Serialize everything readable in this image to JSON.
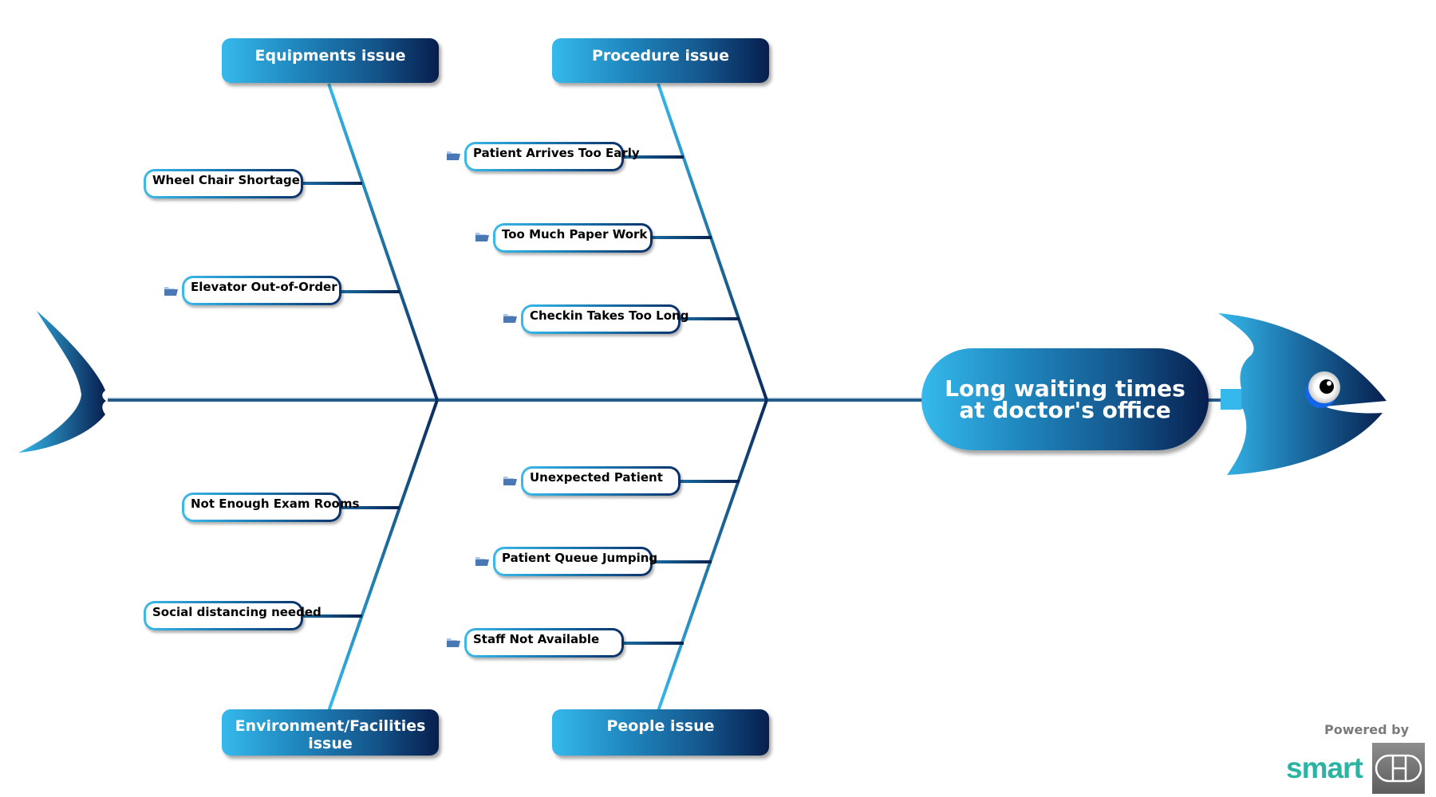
{
  "diagram_type": "fishbone",
  "head": {
    "line1": "Long waiting times",
    "line2": "at doctor's office"
  },
  "categories": [
    {
      "label": "Equipments issue",
      "causes": [
        {
          "label": "Wheel Chair Shortage",
          "has_folder_icon": false
        },
        {
          "label": "Elevator Out-of-Order",
          "has_folder_icon": true
        }
      ]
    },
    {
      "label": "Procedure issue",
      "causes": [
        {
          "label": "Patient Arrives Too Early",
          "has_folder_icon": true
        },
        {
          "label": "Too Much Paper Work",
          "has_folder_icon": true
        },
        {
          "label": "Checkin Takes Too Long",
          "has_folder_icon": true
        }
      ]
    },
    {
      "label_line1": "Environment/Facilities",
      "label_line2": "issue",
      "causes": [
        {
          "label": "Not Enough Exam Rooms",
          "has_folder_icon": false
        },
        {
          "label": "Social distancing needed",
          "has_folder_icon": false
        }
      ]
    },
    {
      "label": "People issue",
      "causes": [
        {
          "label": "Unexpected Patient",
          "has_folder_icon": true
        },
        {
          "label": "Patient Queue Jumping",
          "has_folder_icon": true
        },
        {
          "label": "Staff Not Available",
          "has_folder_icon": true
        }
      ]
    }
  ],
  "branding": {
    "powered_by": "Powered by",
    "logo_word": "smart",
    "logo_mark": "QED"
  },
  "colors": {
    "gradient_light": "#35b9ec",
    "gradient_dark": "#071e4e",
    "spine": "#245d8c",
    "logo_teal": "#2bb3a3",
    "logo_gray": "#6f6f6f",
    "folder": "#4a78b5"
  }
}
